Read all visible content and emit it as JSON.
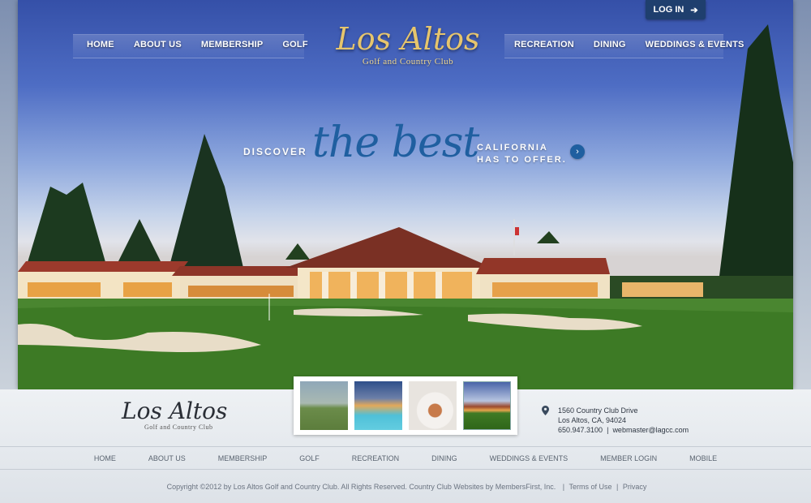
{
  "header": {
    "login_label": "LOG IN",
    "nav_left": [
      "HOME",
      "ABOUT US",
      "MEMBERSHIP",
      "GOLF"
    ],
    "nav_right": [
      "RECREATION",
      "DINING",
      "WEDDINGS & EVENTS"
    ],
    "logo_script": "Los Altos",
    "logo_sub": "Golf and Country Club"
  },
  "hero": {
    "discover": "DISCOVER",
    "the_best": "the best",
    "california_line1": "CALIFORNIA",
    "california_line2": "HAS TO OFFER.",
    "arrow_icon": "chevron-right-icon"
  },
  "footer": {
    "logo_script": "Los Altos",
    "logo_sub": "Golf and Country Club",
    "address_line1": "1560 Country Club Drive",
    "address_line2": "Los Altos, CA, 94024",
    "phone": "650.947.3100",
    "separator": "|",
    "email": "webmaster@lagcc.com",
    "nav": [
      "HOME",
      "ABOUT US",
      "MEMBERSHIP",
      "GOLF",
      "RECREATION",
      "DINING",
      "WEDDINGS & EVENTS",
      "MEMBER LOGIN",
      "MOBILE"
    ],
    "copyright": "Copyright ©2012 by Los Altos Golf and Country Club. All Rights Reserved. Country Club Websites by MembersFirst, Inc.",
    "terms": "Terms of Use",
    "privacy": "Privacy"
  },
  "colors": {
    "accent_gold": "#e6c56d",
    "tagline_blue": "#1f5fa0",
    "login_navy": "#1f3f6e"
  }
}
